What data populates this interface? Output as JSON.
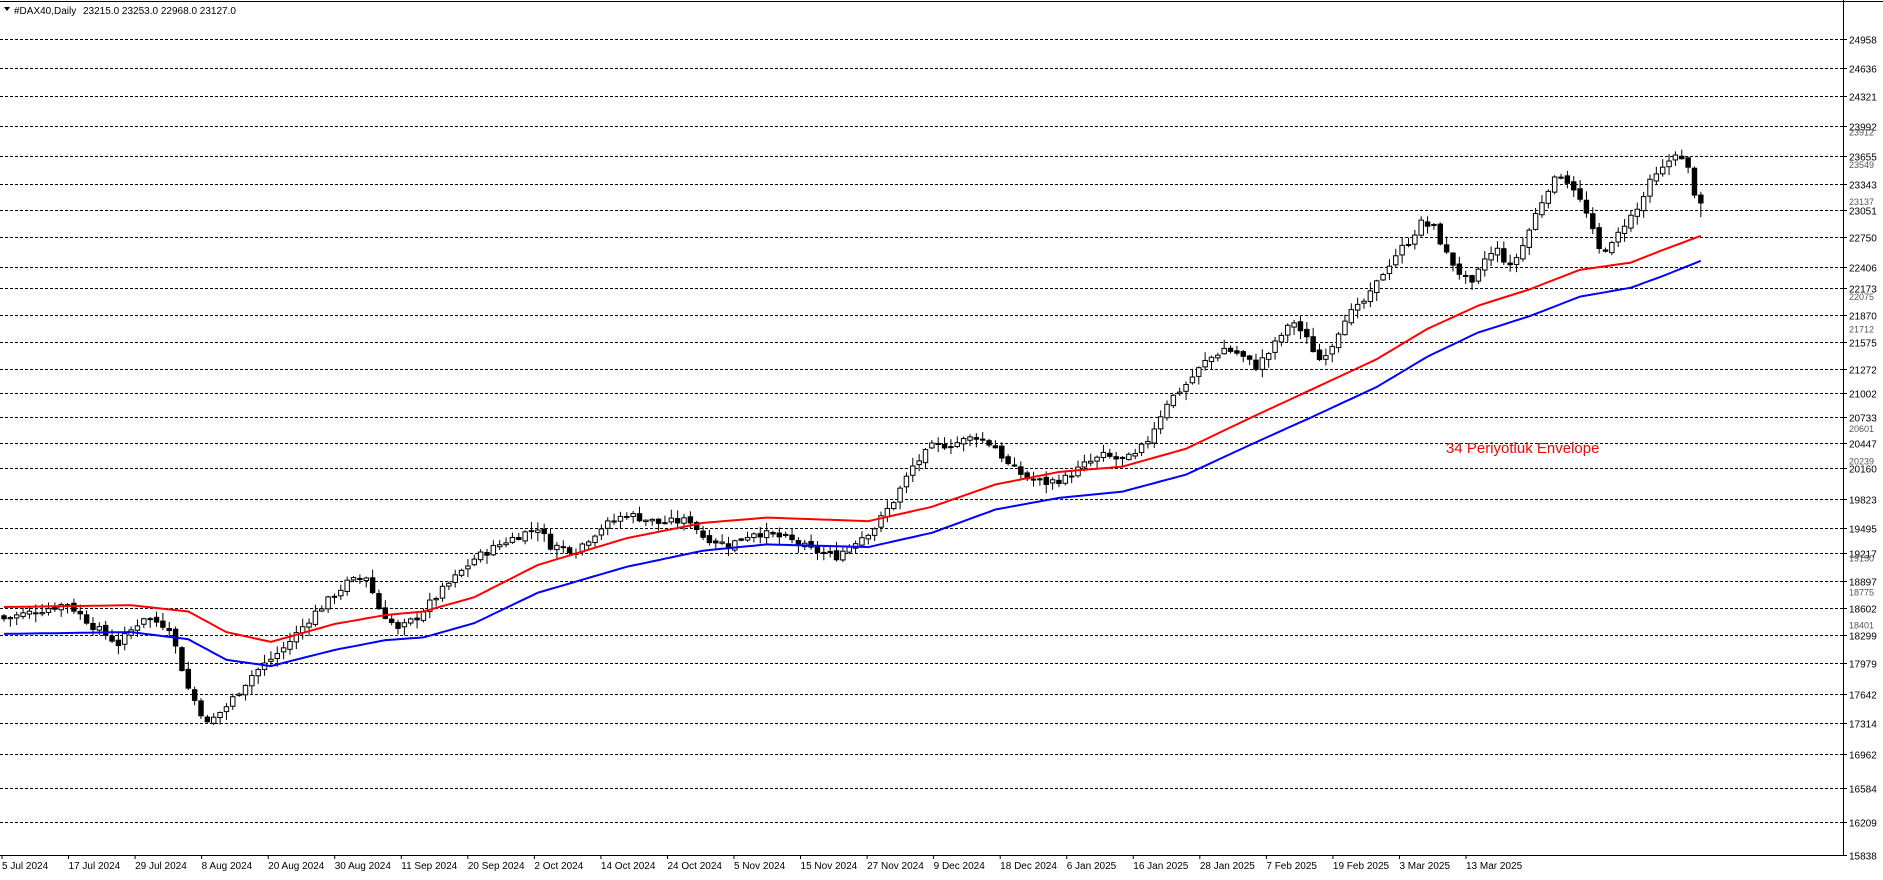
{
  "header": {
    "symbol": "#DAX40,Daily",
    "ohlc": "23215.0 23253.0 22968.0 23127.0",
    "menu_icon": "triangle-down-icon"
  },
  "annotation": {
    "text": "34 Periyotluk Envelope",
    "color": "#ff0000"
  },
  "chart_data": {
    "type": "candlestick",
    "title": "#DAX40,Daily",
    "timeframe": "Daily",
    "last_ohlc": {
      "open": 23215.0,
      "high": 23253.0,
      "low": 22968.0,
      "close": 23127.0
    },
    "ylim": [
      15838,
      25150
    ],
    "grid": "horizontal-dashed",
    "y_ticks": [
      24958,
      24636,
      24321,
      23992,
      23655,
      23343,
      23051,
      22750,
      22406,
      22173,
      21870,
      21575,
      21272,
      21002,
      20733,
      20447,
      20160,
      19823,
      19495,
      19217,
      18897,
      18602,
      18299,
      17979,
      17642,
      17314,
      16962,
      16584,
      16209,
      15838
    ],
    "y_minor_ticks": [
      23912,
      23549,
      23137,
      22075,
      21712,
      20601,
      20239,
      19150,
      18775,
      18401
    ],
    "x_labels": [
      "5 Jul 2024",
      "17 Jul 2024",
      "29 Jul 2024",
      "8 Aug 2024",
      "20 Aug 2024",
      "30 Aug 2024",
      "11 Sep 2024",
      "20 Sep 2024",
      "2 Oct 2024",
      "14 Oct 2024",
      "24 Oct 2024",
      "5 Nov 2024",
      "15 Nov 2024",
      "27 Nov 2024",
      "9 Dec 2024",
      "18 Dec 2024",
      "6 Jan 2025",
      "16 Jan 2025",
      "28 Jan 2025",
      "7 Feb 2025",
      "19 Feb 2025",
      "3 Mar 2025",
      "13 Mar 2025"
    ],
    "close_path": [
      [
        0,
        18480
      ],
      [
        10,
        18650
      ],
      [
        14,
        18400
      ],
      [
        18,
        18200
      ],
      [
        22,
        18500
      ],
      [
        26,
        18390
      ],
      [
        29,
        17700
      ],
      [
        32,
        17300
      ],
      [
        35,
        17500
      ],
      [
        39,
        17850
      ],
      [
        44,
        18150
      ],
      [
        49,
        18550
      ],
      [
        54,
        18880
      ],
      [
        57,
        18950
      ],
      [
        59,
        18600
      ],
      [
        62,
        18350
      ],
      [
        65,
        18500
      ],
      [
        69,
        18800
      ],
      [
        74,
        19150
      ],
      [
        79,
        19350
      ],
      [
        84,
        19500
      ],
      [
        86,
        19300
      ],
      [
        90,
        19250
      ],
      [
        94,
        19500
      ],
      [
        98,
        19650
      ],
      [
        103,
        19550
      ],
      [
        108,
        19580
      ],
      [
        110,
        19400
      ],
      [
        114,
        19300
      ],
      [
        118,
        19450
      ],
      [
        123,
        19380
      ],
      [
        127,
        19250
      ],
      [
        131,
        19180
      ],
      [
        134,
        19350
      ],
      [
        137,
        19500
      ],
      [
        140,
        19800
      ],
      [
        143,
        20180
      ],
      [
        146,
        20400
      ],
      [
        150,
        20450
      ],
      [
        153,
        20520
      ],
      [
        156,
        20400
      ],
      [
        158,
        20200
      ],
      [
        161,
        20050
      ],
      [
        164,
        20000
      ],
      [
        167,
        20050
      ],
      [
        170,
        20200
      ],
      [
        173,
        20300
      ],
      [
        176,
        20250
      ],
      [
        178,
        20300
      ],
      [
        180,
        20480
      ],
      [
        183,
        20900
      ],
      [
        186,
        21100
      ],
      [
        189,
        21350
      ],
      [
        192,
        21500
      ],
      [
        194,
        21450
      ],
      [
        197,
        21300
      ],
      [
        199,
        21450
      ],
      [
        201,
        21650
      ],
      [
        203,
        21800
      ],
      [
        205,
        21600
      ],
      [
        207,
        21380
      ],
      [
        209,
        21550
      ],
      [
        211,
        21850
      ],
      [
        213,
        21950
      ],
      [
        215,
        22100
      ],
      [
        217,
        22350
      ],
      [
        219,
        22550
      ],
      [
        221,
        22700
      ],
      [
        223,
        22900
      ],
      [
        225,
        22850
      ],
      [
        227,
        22550
      ],
      [
        229,
        22350
      ],
      [
        231,
        22200
      ],
      [
        233,
        22500
      ],
      [
        235,
        22600
      ],
      [
        237,
        22400
      ],
      [
        239,
        22650
      ],
      [
        241,
        23000
      ],
      [
        243,
        23300
      ],
      [
        245,
        23450
      ],
      [
        247,
        23300
      ],
      [
        249,
        23000
      ],
      [
        251,
        22600
      ],
      [
        253,
        22650
      ],
      [
        255,
        22900
      ],
      [
        257,
        23050
      ],
      [
        259,
        23350
      ],
      [
        261,
        23500
      ],
      [
        263,
        23700
      ],
      [
        265,
        23500
      ],
      [
        266,
        23250
      ],
      [
        267,
        23127
      ]
    ],
    "series": [
      {
        "name": "",
        "color": "#ff0000",
        "values": [
          [
            0,
            18610
          ],
          [
            20,
            18630
          ],
          [
            29,
            18560
          ],
          [
            35,
            18330
          ],
          [
            42,
            18220
          ],
          [
            52,
            18420
          ],
          [
            60,
            18520
          ],
          [
            66,
            18560
          ],
          [
            74,
            18720
          ],
          [
            84,
            19080
          ],
          [
            98,
            19380
          ],
          [
            110,
            19550
          ],
          [
            120,
            19610
          ],
          [
            136,
            19570
          ],
          [
            146,
            19730
          ],
          [
            156,
            19980
          ],
          [
            166,
            20120
          ],
          [
            176,
            20180
          ],
          [
            186,
            20380
          ],
          [
            196,
            20720
          ],
          [
            206,
            21050
          ],
          [
            216,
            21380
          ],
          [
            224,
            21720
          ],
          [
            232,
            21980
          ],
          [
            240,
            22160
          ],
          [
            248,
            22380
          ],
          [
            256,
            22460
          ],
          [
            261,
            22600
          ],
          [
            267,
            22760
          ]
        ]
      },
      {
        "name": "",
        "color": "#0000ff",
        "values": [
          [
            0,
            18310
          ],
          [
            20,
            18330
          ],
          [
            29,
            18250
          ],
          [
            35,
            18020
          ],
          [
            42,
            17950
          ],
          [
            52,
            18130
          ],
          [
            60,
            18240
          ],
          [
            66,
            18270
          ],
          [
            74,
            18430
          ],
          [
            84,
            18770
          ],
          [
            98,
            19060
          ],
          [
            110,
            19240
          ],
          [
            120,
            19310
          ],
          [
            136,
            19280
          ],
          [
            146,
            19440
          ],
          [
            156,
            19700
          ],
          [
            166,
            19830
          ],
          [
            176,
            19900
          ],
          [
            186,
            20090
          ],
          [
            196,
            20420
          ],
          [
            206,
            20740
          ],
          [
            216,
            21070
          ],
          [
            224,
            21410
          ],
          [
            232,
            21680
          ],
          [
            240,
            21860
          ],
          [
            248,
            22080
          ],
          [
            256,
            22180
          ],
          [
            261,
            22310
          ],
          [
            267,
            22480
          ]
        ]
      }
    ],
    "colors": {
      "bull": "#ffffff",
      "bear": "#000000",
      "outline": "#000000",
      "grid": "#000000"
    }
  }
}
